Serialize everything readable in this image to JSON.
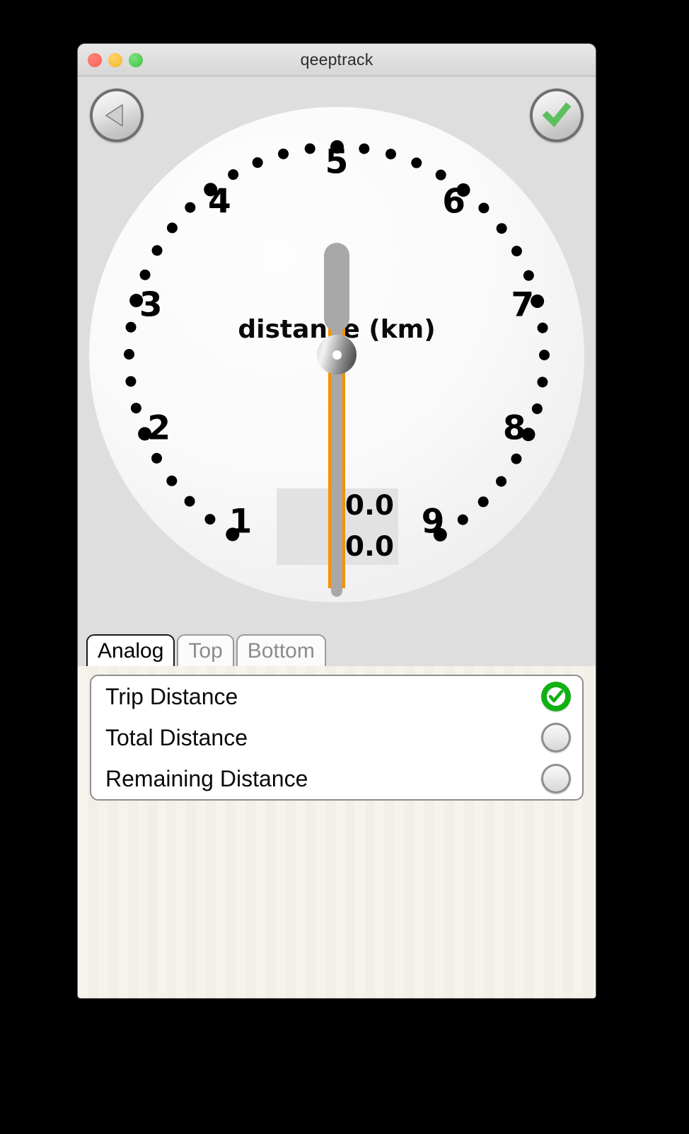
{
  "window": {
    "title": "qeeptrack",
    "traffic_lights": [
      "close",
      "minimize",
      "maximize"
    ]
  },
  "toolbar": {
    "back_label": "back",
    "ok_label": "accept"
  },
  "gauge": {
    "label": "distance (km)",
    "unit": "km",
    "readout_primary": "0.0",
    "readout_secondary": "0.0",
    "needle_value": 0,
    "dial_numbers": [
      "1",
      "2",
      "3",
      "4",
      "5",
      "6",
      "7",
      "8",
      "9"
    ],
    "accent_color": "#f59100",
    "needle_color": "#a8a8a8"
  },
  "tabs": [
    {
      "label": "Analog",
      "active": true
    },
    {
      "label": "Top",
      "active": false
    },
    {
      "label": "Bottom",
      "active": false
    }
  ],
  "options": [
    {
      "label": "Trip Distance",
      "selected": true
    },
    {
      "label": "Total Distance",
      "selected": false
    },
    {
      "label": "Remaining Distance",
      "selected": false
    }
  ]
}
